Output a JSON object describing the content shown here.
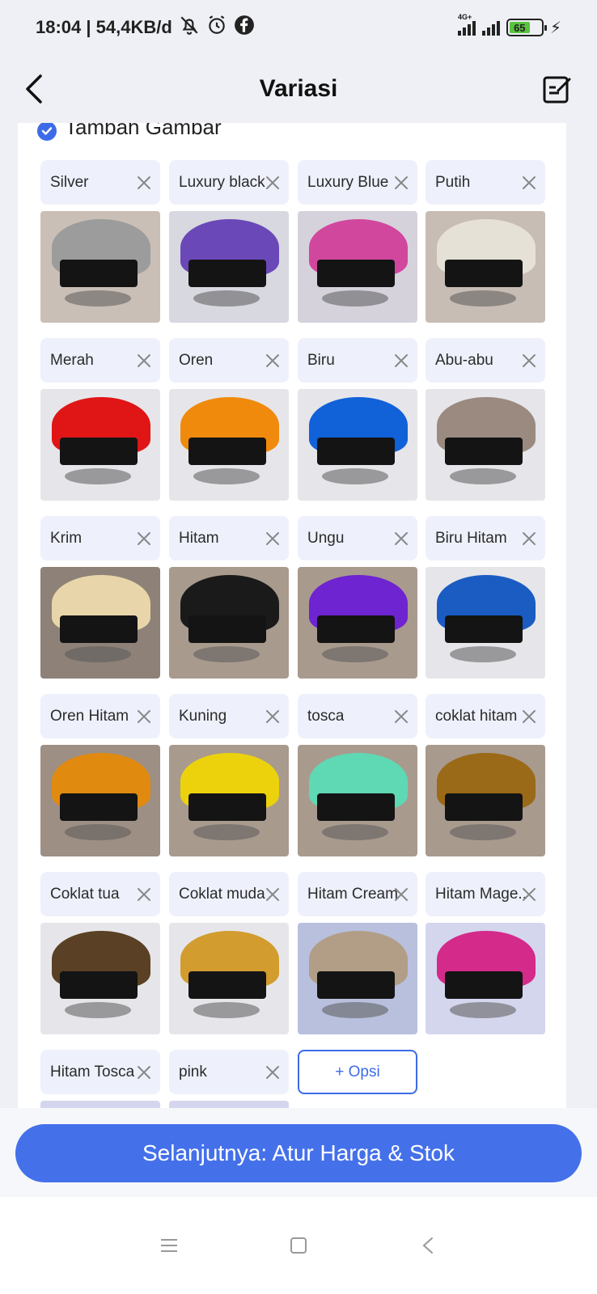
{
  "status_bar": {
    "time_speed": "18:04 | 54,4KB/d",
    "battery": "65",
    "network": "4G+"
  },
  "header": {
    "title": "Variasi"
  },
  "add_image": {
    "label": "Tambah Gambar",
    "checked": true
  },
  "variants": [
    {
      "label": "Silver",
      "hair_color": "#9c9c9c",
      "bg": "#c9bfb6"
    },
    {
      "label": "Luxury black",
      "hair_color": "#6a48b8",
      "bg": "#d8d8e0"
    },
    {
      "label": "Luxury Blue",
      "hair_color": "#d1479e",
      "bg": "#d6d2dc"
    },
    {
      "label": "Putih",
      "hair_color": "#e6e1d6",
      "bg": "#c8bdb4"
    },
    {
      "label": "Merah",
      "hair_color": "#e01515",
      "bg": "#e6e6ea"
    },
    {
      "label": "Oren",
      "hair_color": "#f08a0c",
      "bg": "#e6e6ea"
    },
    {
      "label": "Biru",
      "hair_color": "#1161d8",
      "bg": "#e6e6ea"
    },
    {
      "label": "Abu-abu",
      "hair_color": "#9a8a80",
      "bg": "#e6e6ea"
    },
    {
      "label": "Krim",
      "hair_color": "#e8d6aa",
      "bg": "#8e8178"
    },
    {
      "label": "Hitam",
      "hair_color": "#1a1a1a",
      "bg": "#a99a8e"
    },
    {
      "label": "Ungu",
      "hair_color": "#6e24d0",
      "bg": "#a99a8e"
    },
    {
      "label": "Biru Hitam",
      "hair_color": "#1a5cc2",
      "bg": "#e6e6ea"
    },
    {
      "label": "Oren Hitam",
      "hair_color": "#e08a10",
      "bg": "#9d8f84"
    },
    {
      "label": "Kuning",
      "hair_color": "#ecd20c",
      "bg": "#a99a8e"
    },
    {
      "label": "tosca",
      "hair_color": "#5fd8b4",
      "bg": "#a99a8e"
    },
    {
      "label": "coklat hitam",
      "hair_color": "#9a6a18",
      "bg": "#a99a8e"
    },
    {
      "label": "Coklat tua",
      "hair_color": "#5a4024",
      "bg": "#e6e6ea"
    },
    {
      "label": "Coklat muda",
      "hair_color": "#d29c2e",
      "bg": "#e6e6ea"
    },
    {
      "label": "Hitam Cream",
      "hair_color": "#b29e86",
      "bg": "#b8c0de"
    },
    {
      "label": "Hitam Mage..",
      "hair_color": "#d42a8a",
      "bg": "#d4d6ee"
    },
    {
      "label": "Hitam Tosca",
      "hair_color": "#b4c8e8",
      "bg": "#d4d6ee"
    },
    {
      "label": "pink",
      "hair_color": "#e8a8c4",
      "bg": "#d4d6ee"
    }
  ],
  "add_option_label": "+ Opsi",
  "next_button_label": "Selanjutnya: Atur Harga & Stok",
  "colors": {
    "accent": "#4470ea",
    "chip_bg": "#eef1fb",
    "page_bg": "#eef0f5"
  }
}
